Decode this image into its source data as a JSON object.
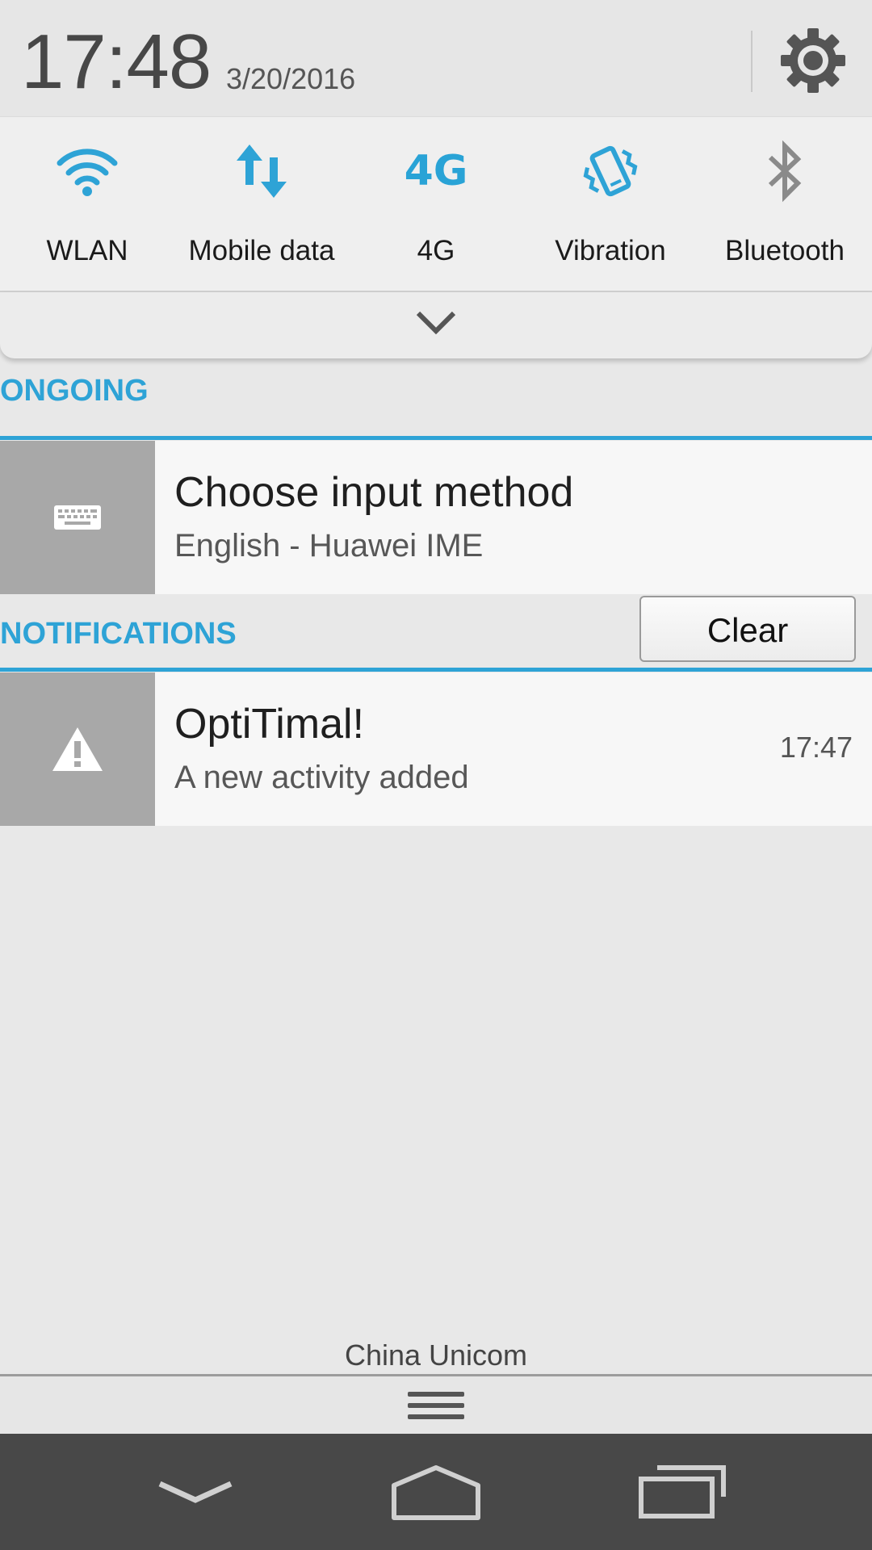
{
  "header": {
    "time": "17:48",
    "date": "3/20/2016",
    "settings_icon": "gear-icon"
  },
  "toggles": [
    {
      "label": "WLAN",
      "icon": "wifi-icon",
      "active": true
    },
    {
      "label": "Mobile data",
      "icon": "mobile-data-icon",
      "active": true
    },
    {
      "label": "4G",
      "icon": "4g-icon",
      "icon_text": "4G",
      "active": true
    },
    {
      "label": "Vibration",
      "icon": "vibration-icon",
      "active": true
    },
    {
      "label": "Bluetooth",
      "icon": "bluetooth-icon",
      "active": false
    }
  ],
  "sections": {
    "ongoing": "ONGOING",
    "notifications": "NOTIFICATIONS"
  },
  "ongoing_item": {
    "title": "Choose input method",
    "subtitle": "English - Huawei IME",
    "icon": "keyboard-icon"
  },
  "clear_label": "Clear",
  "notification_item": {
    "title": "OptiTimal!",
    "subtitle": "A new activity added",
    "time": "17:47",
    "icon": "warning-icon"
  },
  "carrier": "China Unicom",
  "colors": {
    "accent": "#2ea3d6",
    "inactive": "#8a8a8a",
    "navbar": "#484848"
  }
}
